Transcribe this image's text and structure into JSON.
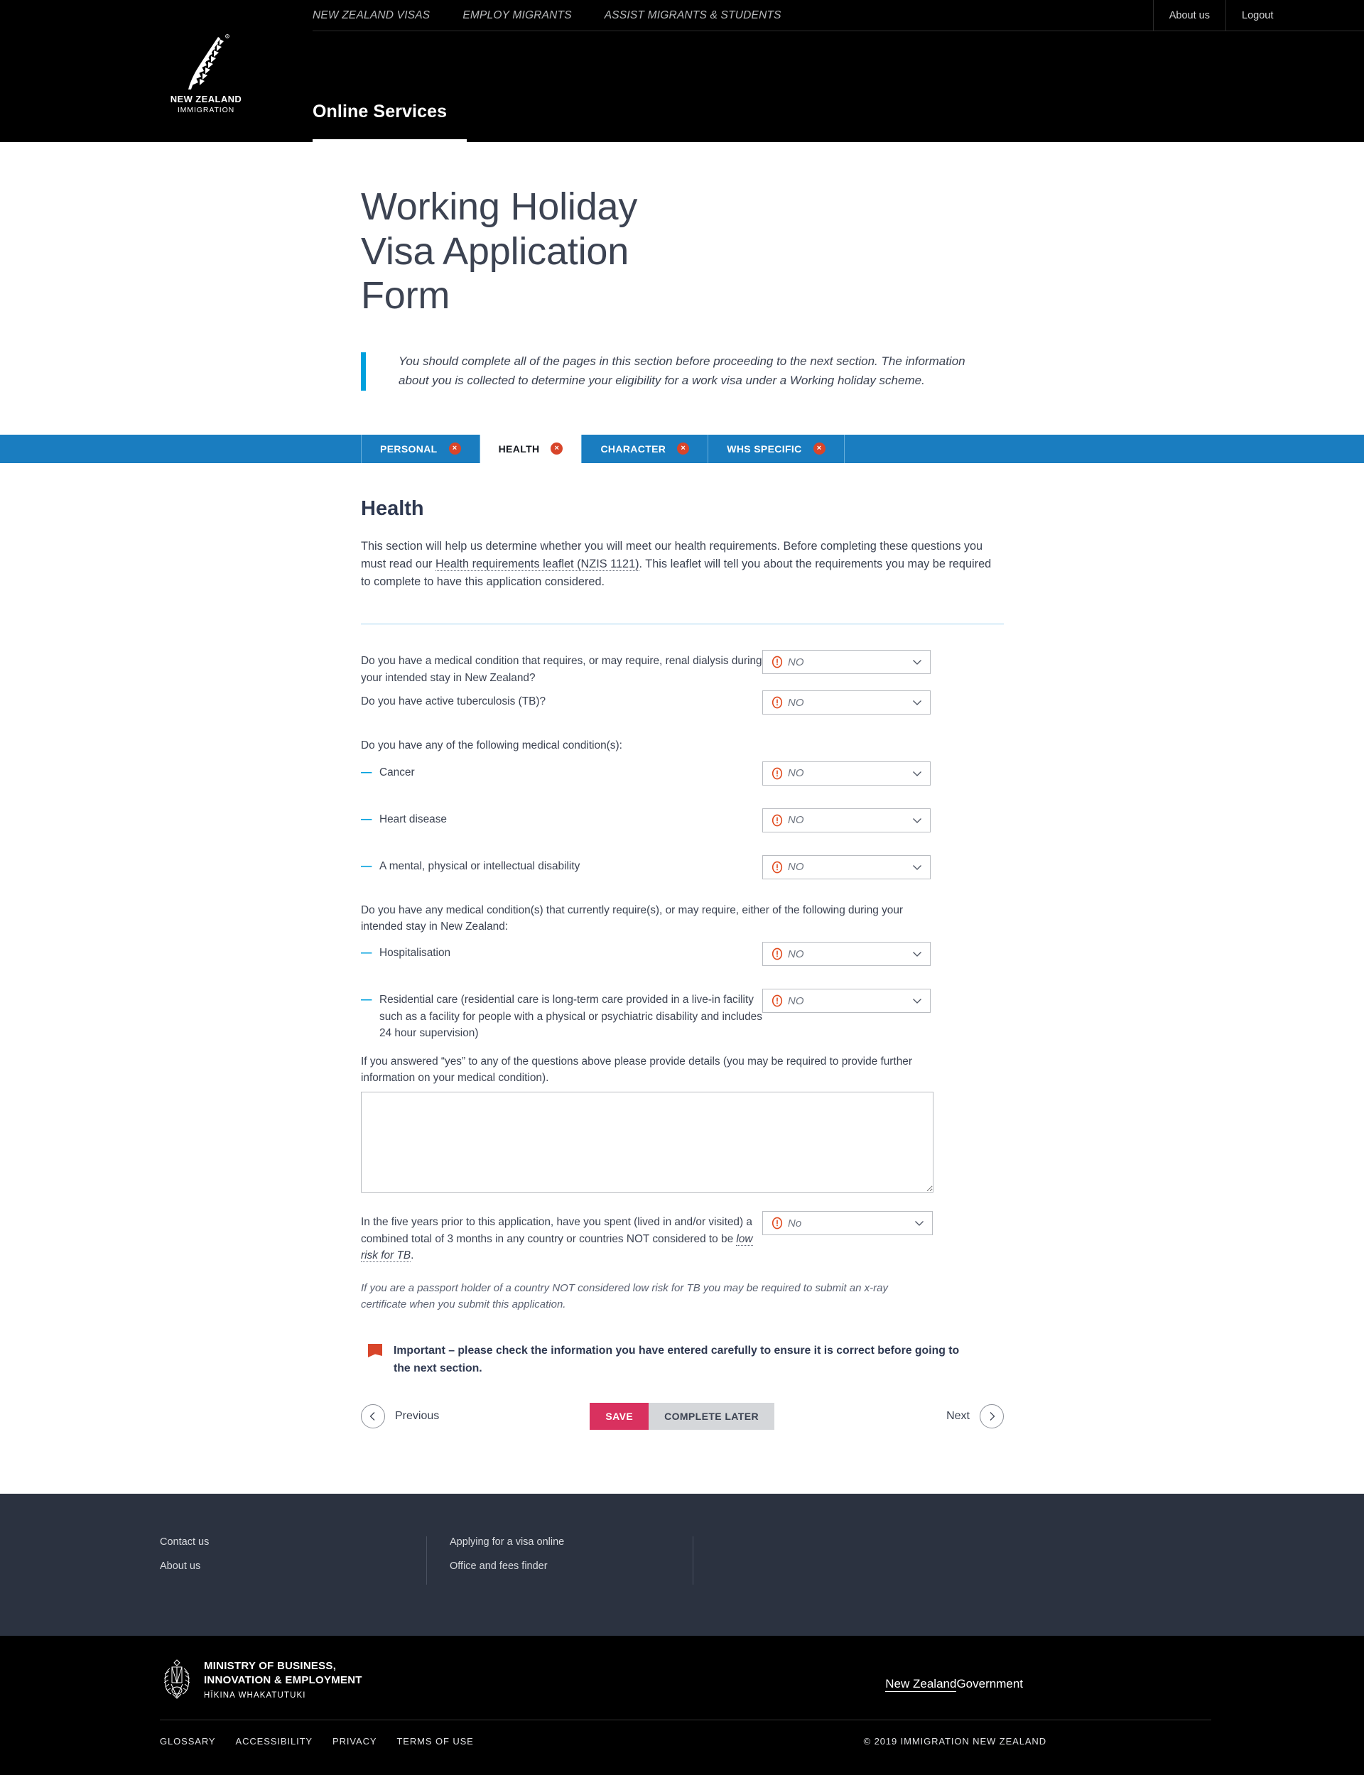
{
  "header": {
    "nav": [
      {
        "label": "NEW ZEALAND VISAS"
      },
      {
        "label": "EMPLOY MIGRANTS"
      },
      {
        "label": "ASSIST MIGRANTS & STUDENTS"
      }
    ],
    "about_us": "About us",
    "logout": "Logout",
    "brand_line1": "NEW ZEALAND",
    "brand_line2": "IMMIGRATION",
    "site_title": "Online Services"
  },
  "hero": {
    "title": "Working Holiday Visa Application Form",
    "intro": "You should complete all of the pages in this section before proceeding to the next section. The information about you is collected to determine your eligibility for a work visa under a Working holiday scheme."
  },
  "tabs": [
    {
      "label": "PERSONAL",
      "active": false,
      "error": true,
      "error_glyph": "×"
    },
    {
      "label": "HEALTH",
      "active": true,
      "error": true,
      "error_glyph": "×"
    },
    {
      "label": "CHARACTER",
      "active": false,
      "error": true,
      "error_glyph": "×"
    },
    {
      "label": "WHS SPECIFIC",
      "active": false,
      "error": true,
      "error_glyph": "×"
    }
  ],
  "section": {
    "title": "Health",
    "description_part1": "This section will help us determine whether you will meet our health requirements. Before completing these questions you must read our ",
    "description_link": "Health requirements leaflet (NZIS 1121)",
    "description_part2": ". This leaflet will tell you about the requirements you may be required to complete to have this application considered."
  },
  "questions": {
    "q_renal_dialysis": "Do you have a medical condition that requires, or may require, renal dialysis during your intended stay in New Zealand?",
    "q_renal_dialysis_value": "NO",
    "q_tb_active": "Do you have active tuberculosis (TB)?",
    "q_tb_active_value": "NO",
    "group1_header": "Do you have any of the following medical condition(s):",
    "q_cancer": "Cancer",
    "q_cancer_value": "NO",
    "q_heart_disease": "Heart disease",
    "q_heart_disease_value": "NO",
    "q_disability": "A mental, physical or intellectual disability",
    "q_disability_value": "NO",
    "group2_header": "Do you have any medical condition(s) that currently require(s), or may require, either of the following during your intended stay in New Zealand:",
    "q_hospitalisation": "Hospitalisation",
    "q_hospitalisation_value": "NO",
    "q_residential_care": "Residential care (residential care is long-term care provided in a live-in facility such as a facility for people with a physical or psychiatric disability and includes 24 hour supervision)",
    "q_residential_care_value": "NO",
    "details_label": "If you answered “yes” to any of the questions above please provide details (you may be required to provide further information on your medical condition).",
    "details_value": "",
    "details_placeholder": "",
    "q_tb_countries_part1": "In the five years prior to this application, have you spent (lived in and/or visited) a combined total of 3 months in any country or countries NOT considered to be ",
    "q_tb_countries_link": "low risk for TB",
    "q_tb_countries_part2": ".",
    "q_tb_countries_value": "No",
    "tb_note": "If you are a passport holder of a country NOT considered low risk for TB you may be required to submit an x-ray certificate when you submit this application."
  },
  "important_notice": "Important – please check the information you have entered carefully to ensure it is correct before going to the next section.",
  "actions": {
    "previous": "Previous",
    "save": "SAVE",
    "complete_later": "COMPLETE LATER",
    "next": "Next"
  },
  "footer": {
    "col1": [
      {
        "label": "Contact us"
      },
      {
        "label": "About us"
      }
    ],
    "col2": [
      {
        "label": "Applying for a visa online"
      },
      {
        "label": "Office and fees finder"
      }
    ],
    "mbie_line1": "MINISTRY OF BUSINESS,",
    "mbie_line2": "INNOVATION & EMPLOYMENT",
    "mbie_line3": "HĪKINA WHAKATUTUKI",
    "nzgov_underlined": "New Zealand",
    "nzgov_rest": "Government",
    "bottom_links": [
      {
        "label": "GLOSSARY"
      },
      {
        "label": "ACCESSIBILITY"
      },
      {
        "label": "PRIVACY"
      },
      {
        "label": "TERMS OF USE"
      }
    ],
    "copyright": "© 2019 IMMIGRATION NEW ZEALAND"
  },
  "colors": {
    "accent_blue": "#00a0dd",
    "tab_blue": "#1a7dc0",
    "error_red": "#d8452a",
    "save_pink": "#d9315f",
    "warn_orange": "#e0491d",
    "footer_navy": "#2b3240"
  }
}
